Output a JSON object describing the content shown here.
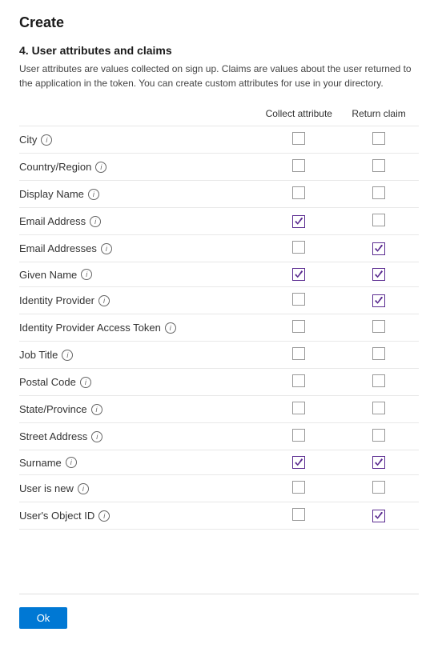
{
  "page": {
    "title": "Create",
    "section_number": "4. User attributes and claims",
    "description": "User attributes are values collected on sign up. Claims are values about the user returned to the application in the token. You can create custom attributes for use in your directory.",
    "col_collect": "Collect attribute",
    "col_return": "Return claim",
    "ok_label": "Ok",
    "attributes": [
      {
        "name": "City",
        "collect": false,
        "return": false
      },
      {
        "name": "Country/Region",
        "collect": false,
        "return": false
      },
      {
        "name": "Display Name",
        "collect": false,
        "return": false
      },
      {
        "name": "Email Address",
        "collect": true,
        "return": false
      },
      {
        "name": "Email Addresses",
        "collect": false,
        "return": true
      },
      {
        "name": "Given Name",
        "collect": true,
        "return": true
      },
      {
        "name": "Identity Provider",
        "collect": false,
        "return": true
      },
      {
        "name": "Identity Provider Access Token",
        "collect": false,
        "return": false
      },
      {
        "name": "Job Title",
        "collect": false,
        "return": false
      },
      {
        "name": "Postal Code",
        "collect": false,
        "return": false
      },
      {
        "name": "State/Province",
        "collect": false,
        "return": false
      },
      {
        "name": "Street Address",
        "collect": false,
        "return": false
      },
      {
        "name": "Surname",
        "collect": true,
        "return": true
      },
      {
        "name": "User is new",
        "collect": false,
        "return": false
      },
      {
        "name": "User's Object ID",
        "collect": false,
        "return": true
      }
    ]
  }
}
